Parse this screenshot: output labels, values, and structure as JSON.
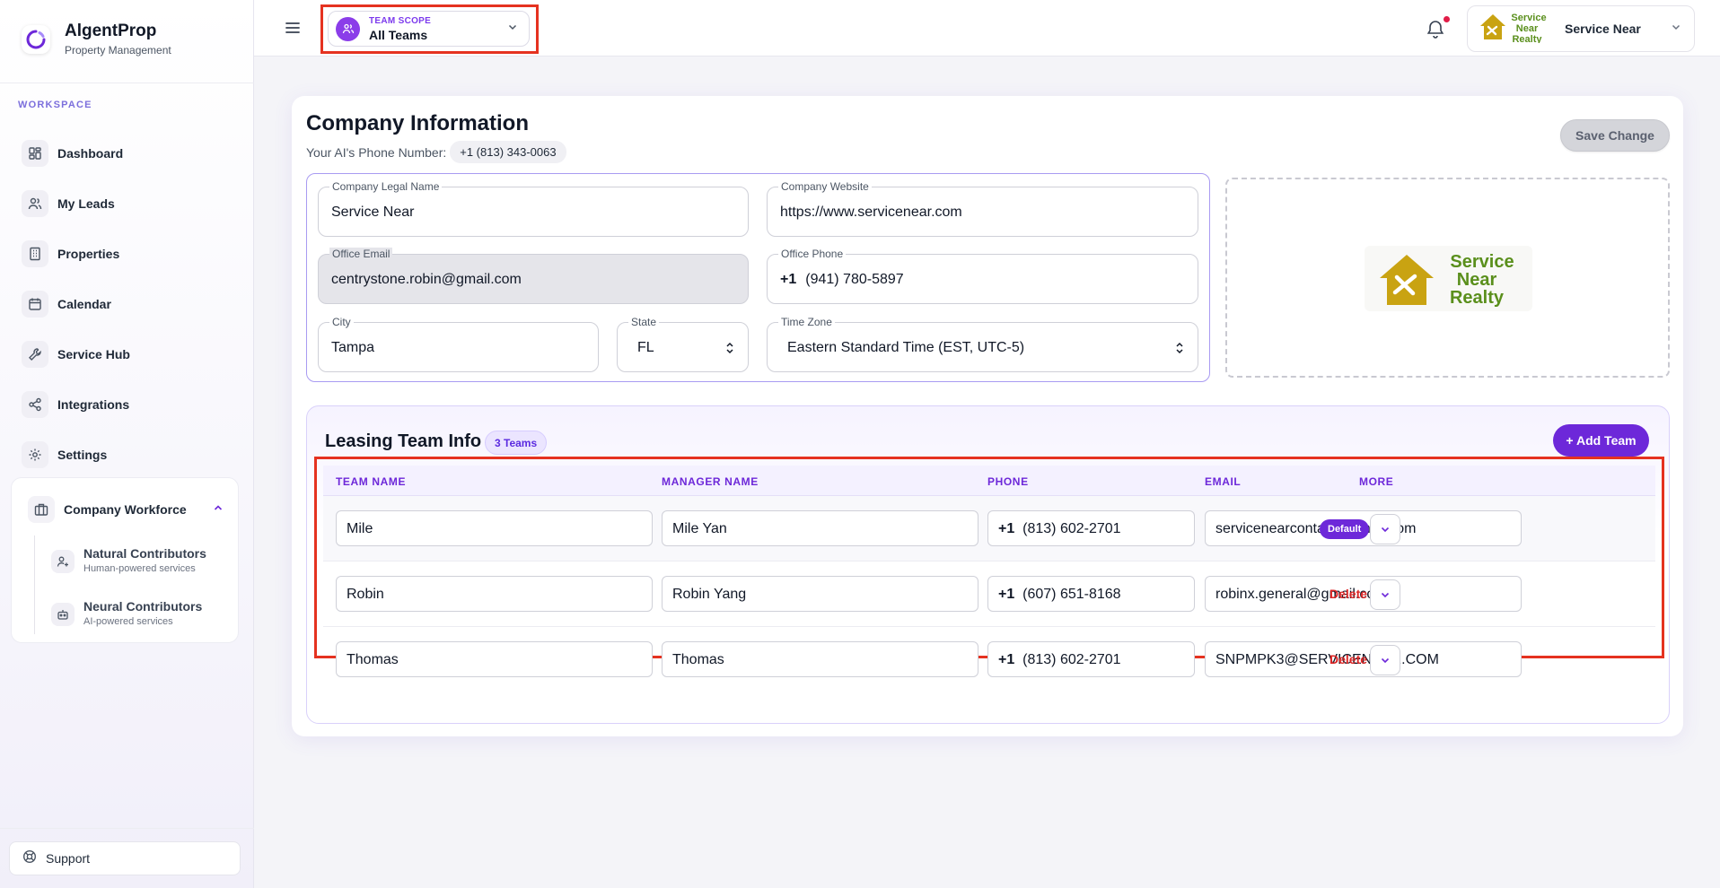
{
  "brand": {
    "name": "AlgentProp",
    "subtitle": "Property Management"
  },
  "sidebar": {
    "section_label": "WORKSPACE",
    "items": [
      {
        "label": "Dashboard",
        "icon": "grid-icon"
      },
      {
        "label": "My Leads",
        "icon": "users-icon"
      },
      {
        "label": "Properties",
        "icon": "building-icon"
      },
      {
        "label": "Calendar",
        "icon": "calendar-icon"
      },
      {
        "label": "Service Hub",
        "icon": "wrench-icon"
      },
      {
        "label": "Integrations",
        "icon": "share-icon"
      },
      {
        "label": "Settings",
        "icon": "gear-icon"
      }
    ],
    "workforce": {
      "title": "Company Workforce",
      "subitems": [
        {
          "title": "Natural Contributors",
          "desc": "Human-powered services"
        },
        {
          "title": "Neural Contributors",
          "desc": "AI-powered services"
        }
      ]
    },
    "support_label": "Support"
  },
  "topbar": {
    "scope_label": "TEAM SCOPE",
    "scope_value": "All Teams",
    "account_name": "Service Near"
  },
  "company": {
    "title": "Company Information",
    "phone_label": "Your AI's Phone Number:",
    "phone_value": "+1 (813) 343-0063",
    "save_label": "Save Change",
    "fields": {
      "legal_name": {
        "label": "Company Legal Name",
        "value": "Service Near"
      },
      "website": {
        "label": "Company Website",
        "value": "https://www.servicenear.com"
      },
      "email": {
        "label": "Office Email",
        "value": "centrystone.robin@gmail.com"
      },
      "phone": {
        "label": "Office Phone",
        "prefix": "+1",
        "value": "(941) 780-5897"
      },
      "city": {
        "label": "City",
        "value": "Tampa"
      },
      "state": {
        "label": "State",
        "value": "FL"
      },
      "timezone": {
        "label": "Time Zone",
        "value": "Eastern Standard Time (EST, UTC-5)"
      }
    },
    "logo_text": [
      "Service",
      "Near",
      "Realty"
    ]
  },
  "leasing": {
    "title": "Leasing Team Info",
    "badge": "3 Teams",
    "add_label": "+ Add Team",
    "columns": [
      "TEAM NAME",
      "MANAGER NAME",
      "PHONE",
      "EMAIL",
      "MORE"
    ],
    "rows": [
      {
        "team": "Mile",
        "manager": "Mile Yan",
        "prefix": "+1",
        "phone": "(813) 602-2701",
        "email": "servicenearcontact@gmail.com",
        "action": "Default"
      },
      {
        "team": "Robin",
        "manager": "Robin Yang",
        "prefix": "+1",
        "phone": "(607) 651-8168",
        "email": "robinx.general@gmail.com",
        "action": "Delete"
      },
      {
        "team": "Thomas",
        "manager": "Thomas",
        "prefix": "+1",
        "phone": "(813) 602-2701",
        "email": "SNPMPK3@SERVICENEAR.COM",
        "action": "Delete"
      }
    ]
  },
  "colors": {
    "accent": "#6d28d9",
    "highlight": "#e53220",
    "danger": "#dc2626",
    "logo_green": "#5a8f1c",
    "logo_gold": "#c9a312"
  }
}
